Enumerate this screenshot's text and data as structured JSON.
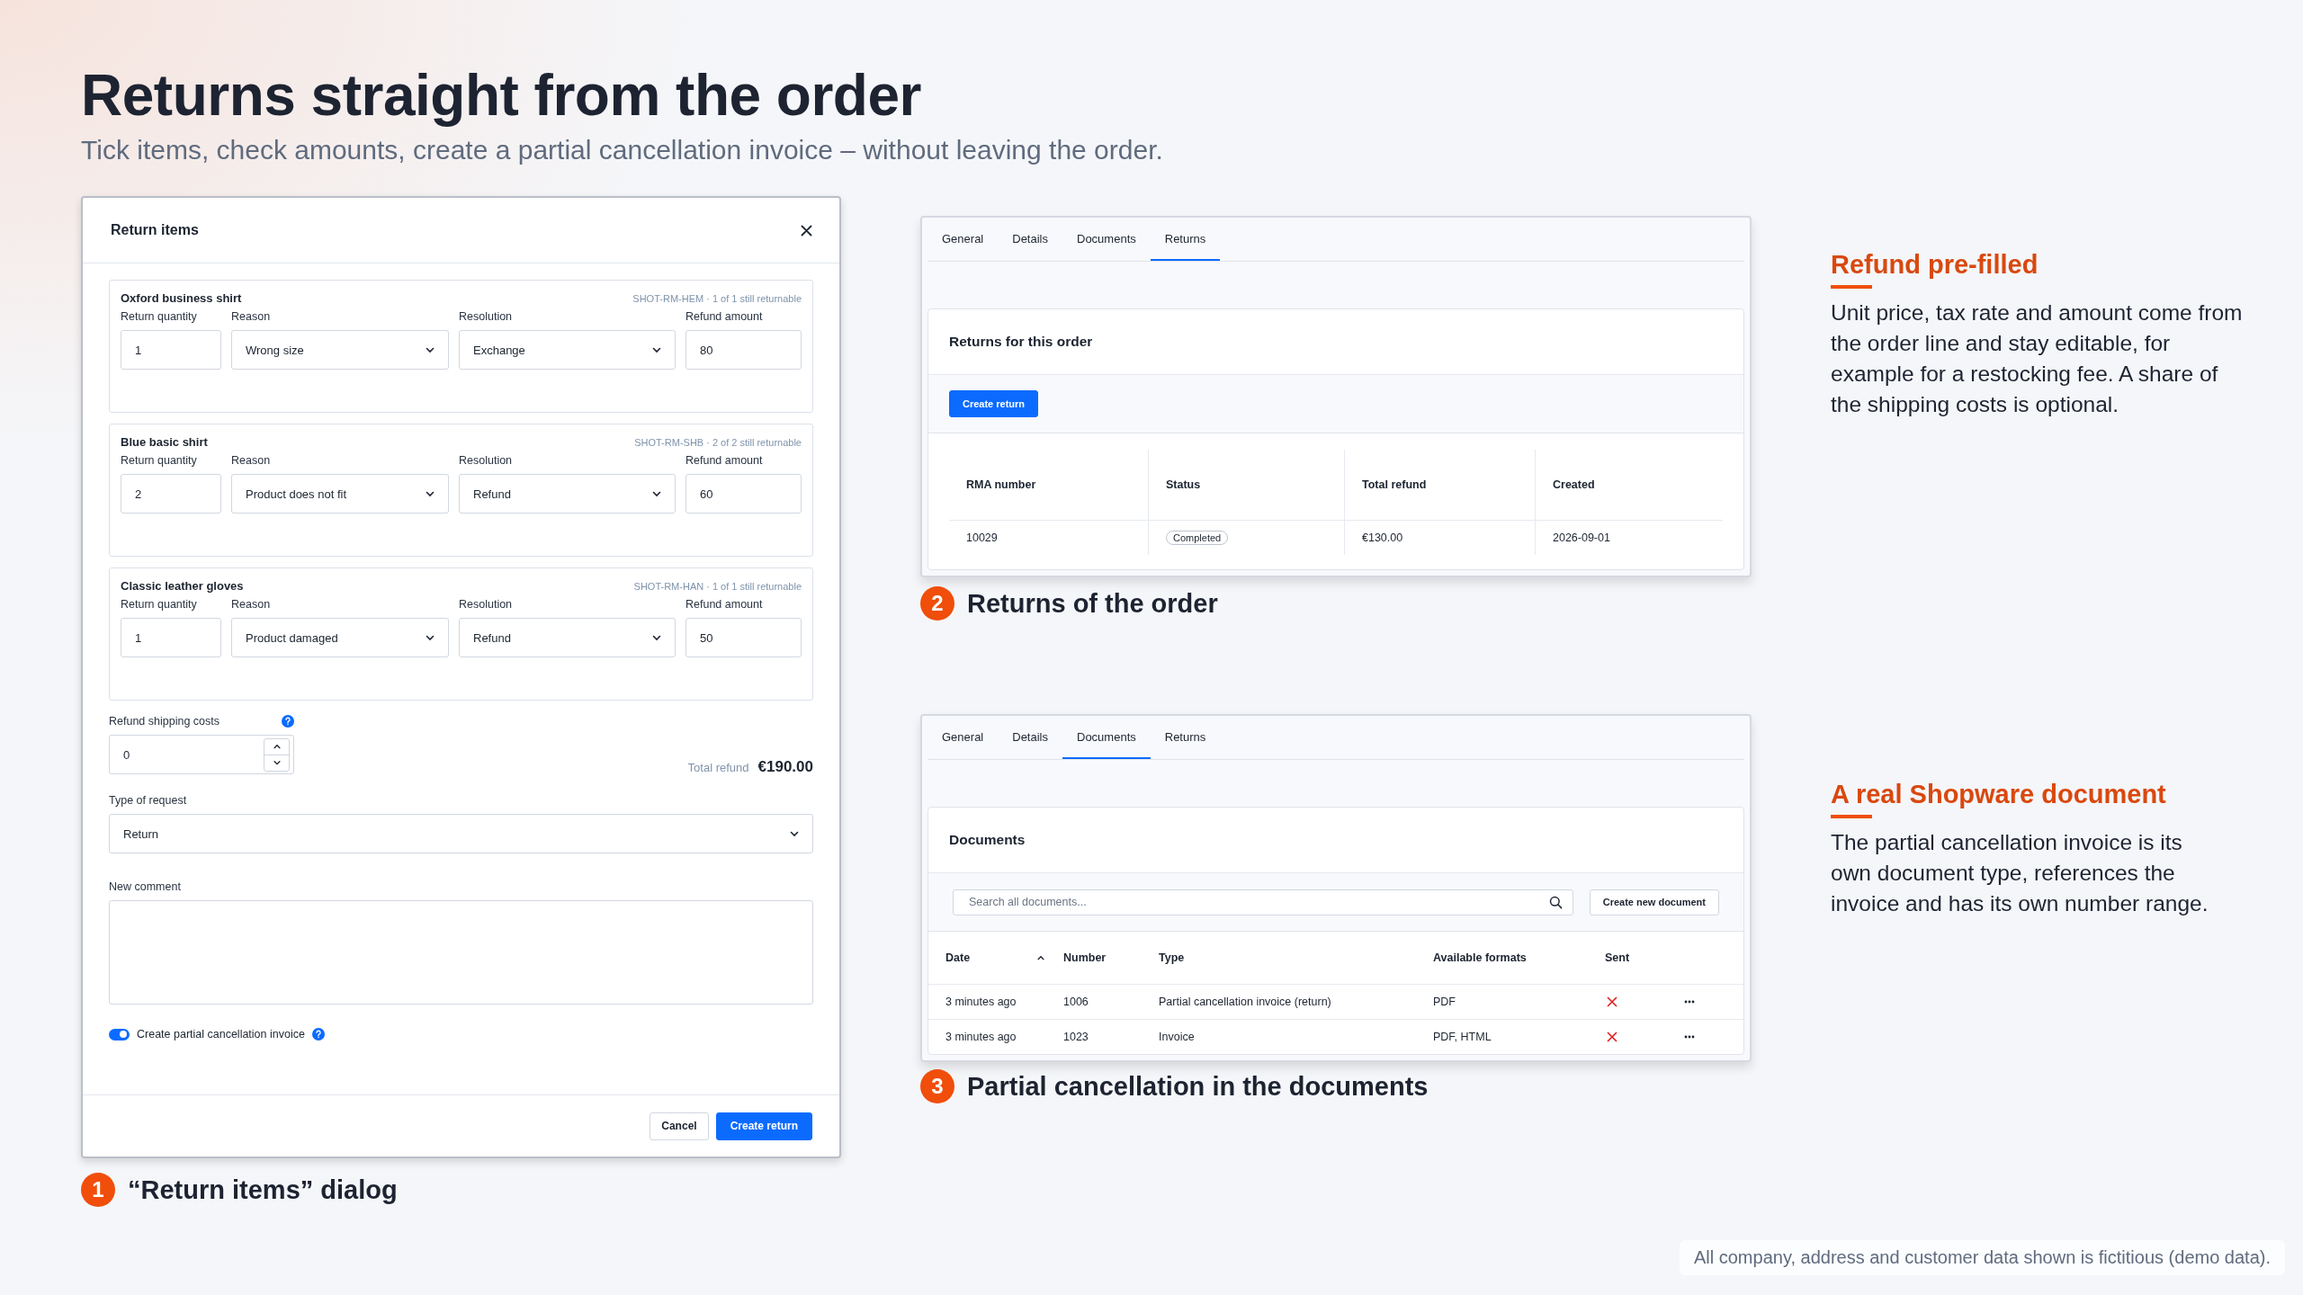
{
  "header": {
    "title": "Returns straight from the order",
    "subtitle": "Tick items, check amounts, create a partial cancellation invoice – without leaving the order."
  },
  "dialog": {
    "title": "Return items",
    "items": [
      {
        "name": "Oxford business shirt",
        "info": "SHOT-RM-HEM · 1 of 1 still returnable",
        "fields": [
          {
            "label": "Return quantity",
            "value": "1",
            "kind": "input"
          },
          {
            "label": "Reason",
            "value": "Wrong size",
            "kind": "select"
          },
          {
            "label": "Resolution",
            "value": "Exchange",
            "kind": "select"
          },
          {
            "label": "Refund amount",
            "value": "80",
            "kind": "input"
          }
        ]
      },
      {
        "name": "Blue basic shirt",
        "info": "SHOT-RM-SHB · 2 of 2 still returnable",
        "fields": [
          {
            "label": "Return quantity",
            "value": "2",
            "kind": "input"
          },
          {
            "label": "Reason",
            "value": "Product does not fit",
            "kind": "select"
          },
          {
            "label": "Resolution",
            "value": "Refund",
            "kind": "select"
          },
          {
            "label": "Refund amount",
            "value": "60",
            "kind": "input"
          }
        ]
      },
      {
        "name": "Classic leather gloves",
        "info": "SHOT-RM-HAN · 1 of 1 still returnable",
        "fields": [
          {
            "label": "Return quantity",
            "value": "1",
            "kind": "input"
          },
          {
            "label": "Reason",
            "value": "Product damaged",
            "kind": "select"
          },
          {
            "label": "Resolution",
            "value": "Refund",
            "kind": "select"
          },
          {
            "label": "Refund amount",
            "value": "50",
            "kind": "input"
          }
        ]
      }
    ],
    "shipping": {
      "label": "Refund shipping costs",
      "value": "0"
    },
    "total": {
      "label": "Total refund",
      "value": "€190.00"
    },
    "request_type": {
      "label": "Type of request",
      "value": "Return"
    },
    "comment": {
      "label": "New comment"
    },
    "toggle": {
      "label": "Create partial cancellation invoice",
      "on": true
    },
    "buttons": [
      {
        "label": "Cancel",
        "kind": "secondary"
      },
      {
        "label": "Create return",
        "kind": "primary"
      }
    ],
    "caption": {
      "number": "1",
      "text": "“Return items” dialog"
    }
  },
  "returns_panel": {
    "tabs": [
      {
        "label": "General",
        "selected": false
      },
      {
        "label": "Details",
        "selected": false
      },
      {
        "label": "Documents",
        "selected": false
      },
      {
        "label": "Returns",
        "selected": true
      }
    ],
    "card_title": "Returns for this order",
    "create_button": "Create return",
    "columns": [
      "RMA number",
      "Status",
      "Total refund",
      "Created"
    ],
    "rows": [
      {
        "rma": "10029",
        "status": "Completed",
        "total": "€130.00",
        "created": "2026-09-01"
      }
    ],
    "caption": {
      "number": "2",
      "text": "Returns of the order"
    }
  },
  "documents_panel": {
    "tabs": [
      {
        "label": "General",
        "selected": false
      },
      {
        "label": "Details",
        "selected": false
      },
      {
        "label": "Documents",
        "selected": true
      },
      {
        "label": "Returns",
        "selected": false
      }
    ],
    "card_title": "Documents",
    "search": {
      "placeholder": "Search all documents..."
    },
    "create_button": "Create new document",
    "columns": [
      {
        "label": "Date",
        "sorted": true
      },
      {
        "label": "Number",
        "sorted": false
      },
      {
        "label": "Type",
        "sorted": false
      },
      {
        "label": "Available formats",
        "sorted": false
      },
      {
        "label": "Sent",
        "sorted": false
      }
    ],
    "rows": [
      {
        "date": "3 minutes ago",
        "number": "1006",
        "type": "Partial cancellation invoice (return)",
        "formats": "PDF",
        "sent": false
      },
      {
        "date": "3 minutes ago",
        "number": "1023",
        "type": "Invoice",
        "formats": "PDF, HTML",
        "sent": false
      }
    ],
    "caption": {
      "number": "3",
      "text": "Partial cancellation in the documents"
    }
  },
  "notes": [
    {
      "title": "Refund pre-filled",
      "body": "Unit price, tax rate and amount come from the order line and stay editable, for example for a restocking fee. A share of the shipping costs is optional."
    },
    {
      "title": "A real Shopware document",
      "body": "The partial cancellation invoice is its own document type, references the invoice and has its own number range."
    }
  ],
  "footer": "All company, address and customer data shown is fictitious (demo data)."
}
